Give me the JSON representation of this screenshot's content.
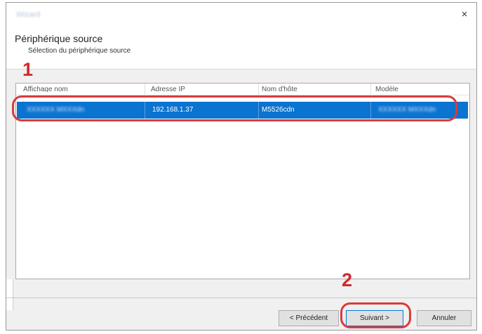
{
  "window": {
    "title": "Wizard",
    "close_glyph": "×"
  },
  "header": {
    "title": "Périphérique source",
    "subtitle": "Sélection du périphérique source"
  },
  "annotations": {
    "step1": "1",
    "step2": "2"
  },
  "table": {
    "columns": [
      "Affichage nom",
      "Adresse IP",
      "Nom d'hôte",
      "Modèle"
    ],
    "rows": [
      {
        "display_name": "XXXXXX MXXXdn",
        "ip": "192.168.1.37",
        "hostname": "M5526cdn",
        "model": "XXXXXX MXXXdn"
      }
    ]
  },
  "buttons": {
    "back": "< Précédent",
    "next": "Suivant >",
    "cancel": "Annuler"
  },
  "colors": {
    "selection": "#0b73d0",
    "annotation": "#d02a2a"
  }
}
